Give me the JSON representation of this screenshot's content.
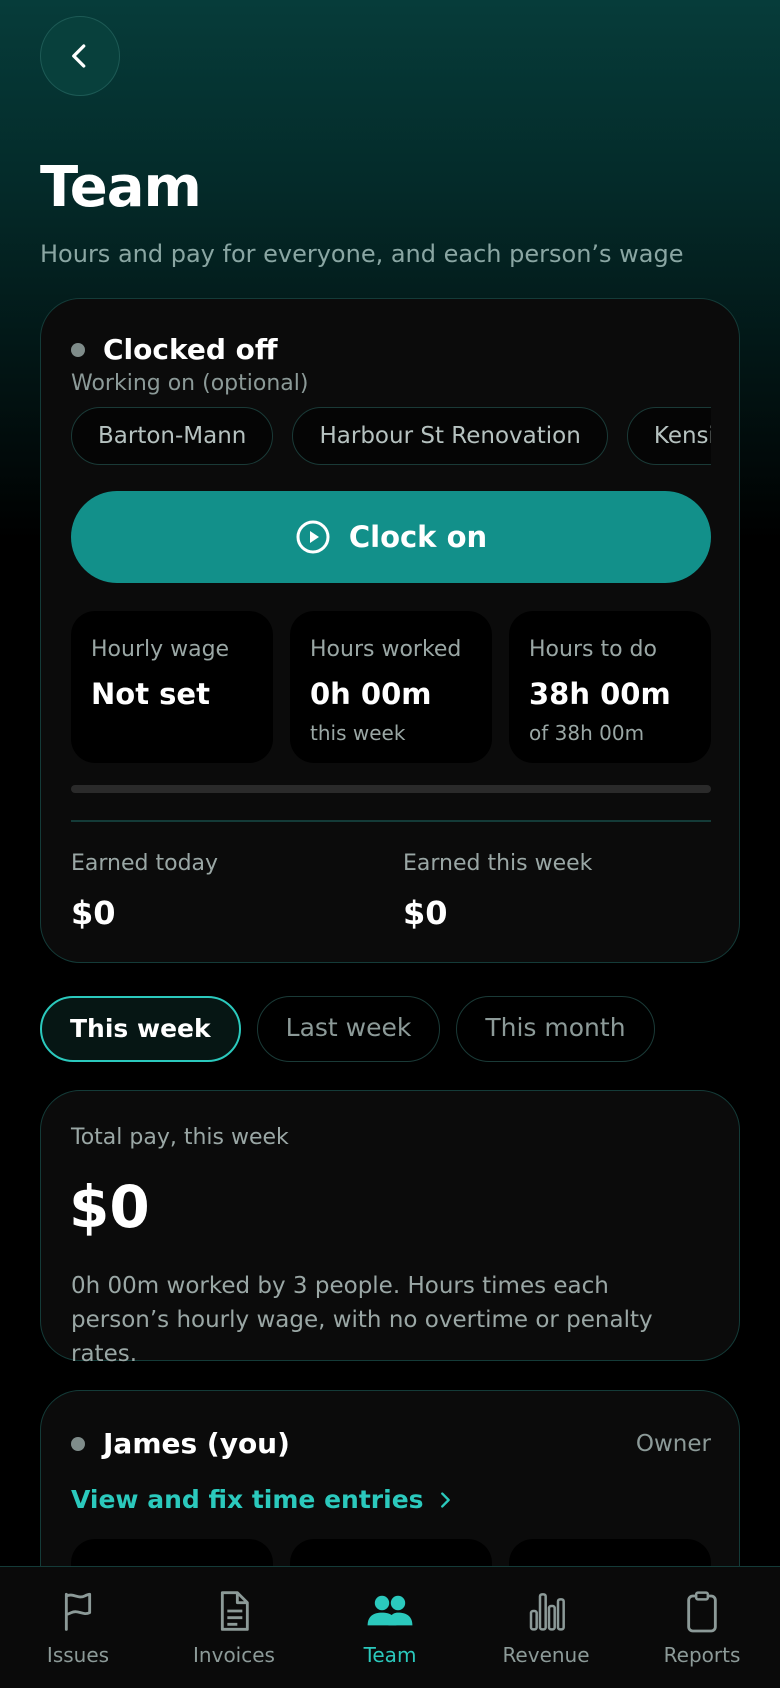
{
  "header": {
    "back_icon": "chevron-left-icon",
    "title": "Team",
    "subtitle": "Hours and pay for everyone, and each person’s wage"
  },
  "clock_card": {
    "status": "Clocked off",
    "working_on_label": "Working on (optional)",
    "jobs": [
      "Barton-Mann",
      "Harbour St Renovation",
      "Kensington"
    ],
    "clock_button_label": "Clock on",
    "clock_button_icon": "play-circle-icon",
    "stats": [
      {
        "label": "Hourly wage",
        "value": "Not set",
        "sub": ""
      },
      {
        "label": "Hours worked",
        "value": "0h 00m",
        "sub": "this week"
      },
      {
        "label": "Hours to do",
        "value": "38h 00m",
        "sub": "of 38h 00m"
      }
    ],
    "progress_fraction": 0,
    "earned_today_label": "Earned today",
    "earned_today": "$0",
    "earned_week_label": "Earned this week",
    "earned_week": "$0"
  },
  "period_tabs": [
    "This week",
    "Last week",
    "This month"
  ],
  "active_period": "This week",
  "total_card": {
    "label": "Total pay, this week",
    "amount": "$0",
    "description": "0h 00m worked by 3 people. Hours times each person’s hourly wage, with no overtime or penalty rates."
  },
  "member_card": {
    "name": "James (you)",
    "role": "Owner",
    "link_label": "View and fix time entries"
  },
  "bottom_nav": [
    {
      "label": "Issues",
      "icon": "flag-icon",
      "active": false
    },
    {
      "label": "Invoices",
      "icon": "document-icon",
      "active": false
    },
    {
      "label": "Team",
      "icon": "people-icon",
      "active": true
    },
    {
      "label": "Revenue",
      "icon": "bar-chart-icon",
      "active": false
    },
    {
      "label": "Reports",
      "icon": "clipboard-icon",
      "active": false
    }
  ],
  "colors": {
    "accent": "#12908a",
    "accent_text": "#2bc9bd",
    "muted_text": "#8c9a98",
    "card_background": "#0b0b0b"
  }
}
